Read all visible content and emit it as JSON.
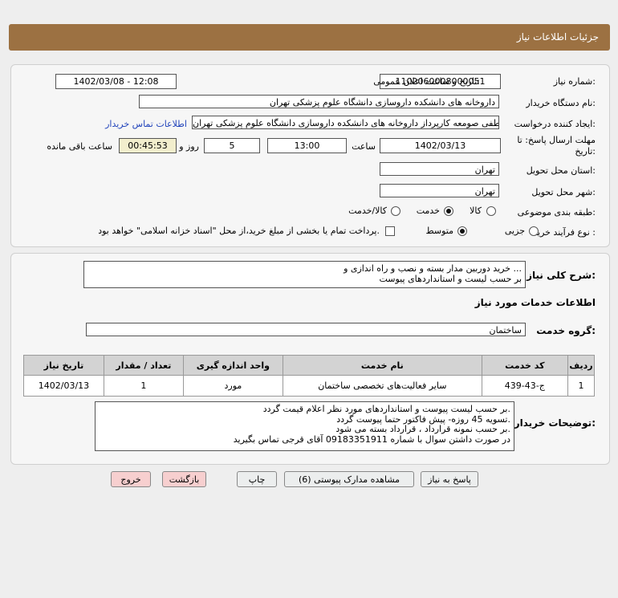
{
  "header": {
    "title": "جزئیات اطلاعات نیاز"
  },
  "form": {
    "need_number_label": "شماره نیاز:",
    "need_number": "1102060008000051",
    "announce_label": "تاریخ و ساعت اعلان عمومی:",
    "announce_value": "1402/03/08 - 12:08",
    "buyer_org_label": "نام دستگاه خریدار:",
    "buyer_org": "داروخانه های دانشکده داروسازی دانشگاه علوم پزشکی تهران",
    "creator_label": "ایجاد کننده درخواست:",
    "creator": "علی لطفی صومعه کارپرداز داروخانه های دانشکده داروسازی دانشگاه علوم پزشکی تهران",
    "contact_link": "اطلاعات تماس خریدار",
    "deadline_label_1": "مهلت ارسال پاسخ: تا",
    "deadline_label_2": "تاریخ:",
    "deadline_date": "1402/03/13",
    "time_label": "ساعت",
    "deadline_time": "13:00",
    "days_value": "5",
    "days_label": "روز و",
    "remaining_time": "00:45:53",
    "remaining_label": "ساعت باقی مانده",
    "province_label": "استان محل تحویل:",
    "province": "تهران",
    "city_label": "شهر محل تحویل:",
    "city": "تهران",
    "category_label": "طبقه بندی موضوعی:",
    "category_options": [
      "کالا",
      "خدمت",
      "کالا/خدمت"
    ],
    "category_selected": "خدمت",
    "process_label": "نوع فرآیند خرید :",
    "process_options": [
      "جزیی",
      "متوسط"
    ],
    "process_selected": "متوسط",
    "payment_text": "پرداخت تمام یا بخشی از مبلغ خرید،از محل \"اسناد خزانه اسلامی\" خواهد بود."
  },
  "desc": {
    "label": "شرح کلی نیاز:",
    "line1": "خرید دوربین مدار بسته و نصب و راه اندازی و ...",
    "line2": "بر حسب لیست و استانداردهای پیوست"
  },
  "services": {
    "section_title": "اطلاعات خدمات مورد نیاز",
    "group_label": "گروه خدمت:",
    "group_value": "ساختمان",
    "columns": [
      "ردیف",
      "کد خدمت",
      "نام خدمت",
      "واحد اندازه گیری",
      "تعداد / مقدار",
      "تاریخ نیاز"
    ],
    "rows": [
      [
        "1",
        "ج-43-439",
        "سایر فعالیت‌های تخصصی ساختمان",
        "مورد",
        "1",
        "1402/03/13"
      ]
    ]
  },
  "buyer_notes": {
    "label": "توضیحات خریدار:",
    "lines": [
      "بر حسب لیست پیوست و استانداردهای مورد نظر اعلام قیمت گردد.",
      "تسویه 45 روزه- پیش فاکتور حتما پیوست گردد.",
      "بر حسب نمونه قرارداد ، قرارداد بسته می شود.",
      "در صورت داشتن سوال با شماره 09183351911 آقای قرجی تماس بگیرید"
    ]
  },
  "buttons": {
    "reply": "پاسخ به نیاز",
    "attachments": "مشاهده مدارک پیوستی (6)",
    "print": "چاپ",
    "back": "بازگشت",
    "exit": "خروج"
  },
  "colors": {
    "header_bg": "#9c7142",
    "link": "#2244bb",
    "remaining_bg": "#f2eecd",
    "danger_btn": "#f7cfcf"
  }
}
